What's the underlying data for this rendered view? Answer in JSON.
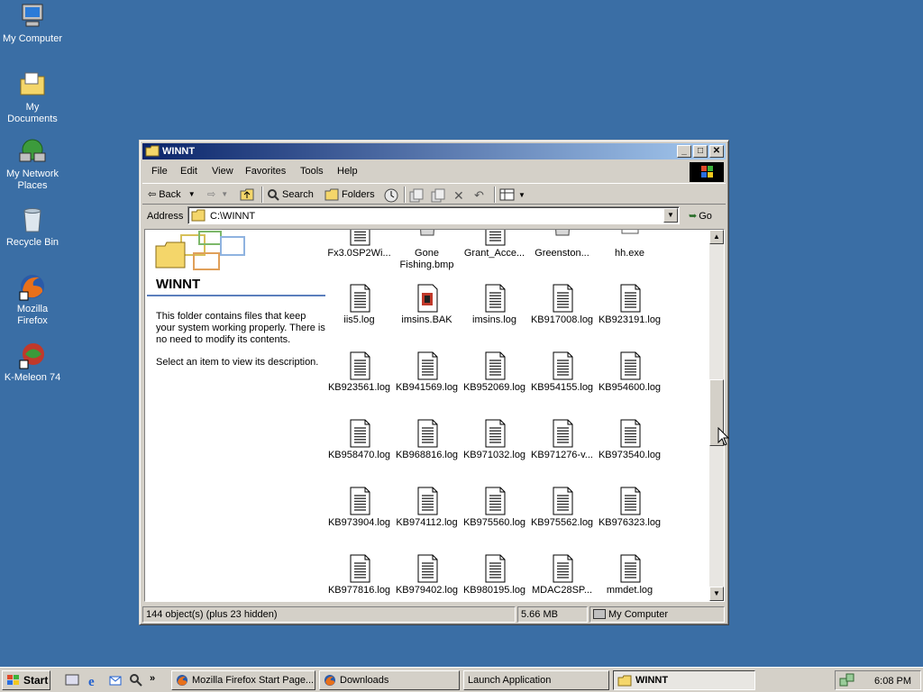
{
  "desktop": {
    "icons": [
      {
        "label": "My Computer",
        "icon": "my-computer-icon"
      },
      {
        "label": "My Documents",
        "icon": "my-documents-icon"
      },
      {
        "label": "My Network Places",
        "icon": "network-places-icon"
      },
      {
        "label": "Recycle Bin",
        "icon": "recycle-bin-icon"
      },
      {
        "label": "Mozilla Firefox",
        "icon": "firefox-icon"
      },
      {
        "label": "K-Meleon 74",
        "icon": "kmeleon-icon"
      }
    ]
  },
  "window": {
    "title": "WINNT",
    "menu": [
      "File",
      "Edit",
      "View",
      "Favorites",
      "Tools",
      "Help"
    ],
    "toolbar": {
      "back": "Back",
      "search": "Search",
      "folders": "Folders"
    },
    "address": {
      "label": "Address",
      "value": "C:\\WINNT",
      "go": "Go"
    },
    "webview": {
      "title": "WINNT",
      "description": "This folder contains files that keep your system working properly. There is no need to modify its contents.",
      "hint": "Select an item to view its description."
    },
    "files": [
      {
        "name": "Fx3.0SP2Wi...",
        "icon": "text-file-icon"
      },
      {
        "name": "Gone Fishing.bmp",
        "icon": "bitmap-file-icon"
      },
      {
        "name": "Grant_Acce...",
        "icon": "text-file-icon"
      },
      {
        "name": "Greenston...",
        "icon": "bitmap-file-icon"
      },
      {
        "name": "hh.exe",
        "icon": "exe-file-icon"
      },
      {
        "name": "iis5.log",
        "icon": "log-file-icon"
      },
      {
        "name": "imsins.BAK",
        "icon": "bak-file-icon"
      },
      {
        "name": "imsins.log",
        "icon": "log-file-icon"
      },
      {
        "name": "KB917008.log",
        "icon": "log-file-icon"
      },
      {
        "name": "KB923191.log",
        "icon": "log-file-icon"
      },
      {
        "name": "KB923561.log",
        "icon": "log-file-icon"
      },
      {
        "name": "KB941569.log",
        "icon": "log-file-icon"
      },
      {
        "name": "KB952069.log",
        "icon": "log-file-icon"
      },
      {
        "name": "KB954155.log",
        "icon": "log-file-icon"
      },
      {
        "name": "KB954600.log",
        "icon": "log-file-icon"
      },
      {
        "name": "KB958470.log",
        "icon": "log-file-icon"
      },
      {
        "name": "KB968816.log",
        "icon": "log-file-icon"
      },
      {
        "name": "KB971032.log",
        "icon": "log-file-icon"
      },
      {
        "name": "KB971276-v...",
        "icon": "log-file-icon"
      },
      {
        "name": "KB973540.log",
        "icon": "log-file-icon"
      },
      {
        "name": "KB973904.log",
        "icon": "log-file-icon"
      },
      {
        "name": "KB974112.log",
        "icon": "log-file-icon"
      },
      {
        "name": "KB975560.log",
        "icon": "log-file-icon"
      },
      {
        "name": "KB975562.log",
        "icon": "log-file-icon"
      },
      {
        "name": "KB976323.log",
        "icon": "log-file-icon"
      },
      {
        "name": "KB977816.log",
        "icon": "log-file-icon"
      },
      {
        "name": "KB979402.log",
        "icon": "log-file-icon"
      },
      {
        "name": "KB980195.log",
        "icon": "log-file-icon"
      },
      {
        "name": "MDAC28SP...",
        "icon": "log-file-icon"
      },
      {
        "name": "mmdet.log",
        "icon": "log-file-icon"
      }
    ],
    "status": {
      "objects": "144 object(s) (plus 23 hidden)",
      "size": "5.66 MB",
      "zone": "My Computer"
    }
  },
  "taskbar": {
    "start": "Start",
    "tasks": [
      {
        "label": "Mozilla Firefox Start Page...",
        "icon": "firefox-icon"
      },
      {
        "label": "Downloads",
        "icon": "firefox-icon"
      },
      {
        "label": "Launch Application",
        "icon": ""
      },
      {
        "label": "WINNT",
        "icon": "folder-icon"
      }
    ],
    "clock": "6:08 PM"
  },
  "colors": {
    "desktop": "#3a6ea5",
    "titlebar_start": "#0a246a",
    "titlebar_end": "#a6caf0",
    "face": "#d4d0c8"
  }
}
